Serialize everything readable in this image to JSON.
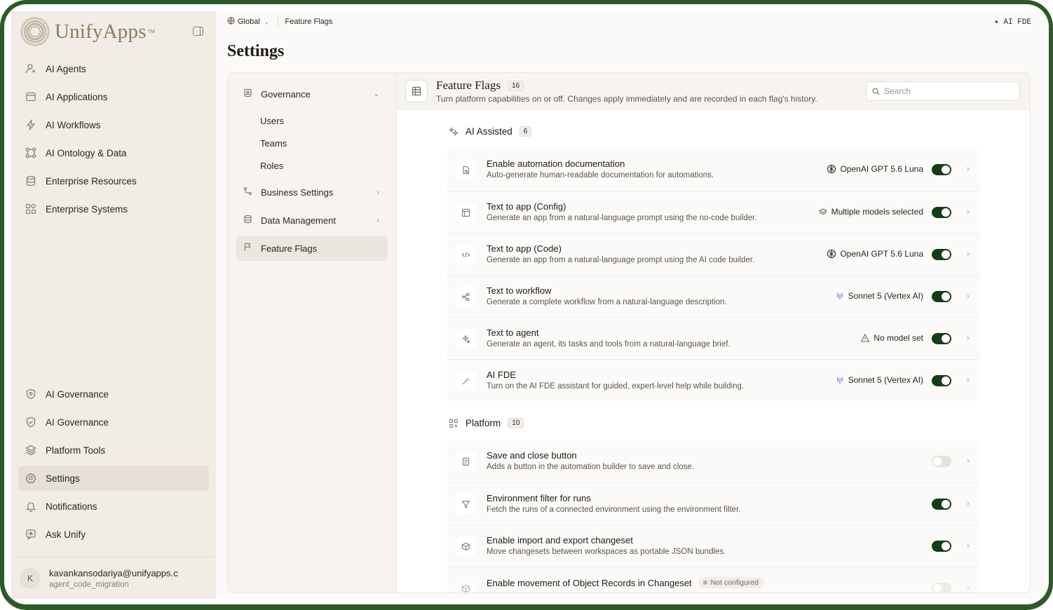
{
  "brand": {
    "name": "UnifyApps",
    "tm": "TM"
  },
  "sidebar": {
    "top_items": [
      {
        "label": "AI Agents",
        "icon": "user-sparkle-icon"
      },
      {
        "label": "AI Applications",
        "icon": "window-icon"
      },
      {
        "label": "AI Workflows",
        "icon": "bolt-icon"
      },
      {
        "label": "AI Ontology & Data",
        "icon": "graph-icon"
      },
      {
        "label": "Enterprise Resources",
        "icon": "database-icon"
      },
      {
        "label": "Enterprise Systems",
        "icon": "grid-icon"
      }
    ],
    "bottom_items": [
      {
        "label": "AI Governance",
        "icon": "shield-icon"
      },
      {
        "label": "AI Governance",
        "icon": "shield-check-icon"
      },
      {
        "label": "Platform Tools",
        "icon": "layers-icon"
      },
      {
        "label": "Settings",
        "icon": "gear-icon",
        "active": true
      },
      {
        "label": "Notifications",
        "icon": "bell-icon"
      },
      {
        "label": "Ask Unify",
        "icon": "chat-icon"
      }
    ],
    "user": {
      "initial": "K",
      "email": "kavankansodariya@unifyapps.c",
      "org": "agent_code_migration"
    }
  },
  "topbar": {
    "scope": "Global",
    "breadcrumb": "Feature Flags",
    "ai_fde": "✦ AI FDE"
  },
  "page": {
    "title": "Settings"
  },
  "settings_nav": {
    "governance": "Governance",
    "sub_items": [
      "Users",
      "Teams",
      "Roles"
    ],
    "business_settings": "Business Settings",
    "data_management": "Data Management",
    "feature_flags": "Feature Flags"
  },
  "feature_flags": {
    "title": "Feature Flags",
    "count": "16",
    "description": "Turn platform capabilities on or off. Changes apply immediately and are recorded in each flag's history.",
    "search_placeholder": "Search",
    "sections": [
      {
        "title": "AI Assisted",
        "count": "6",
        "flags": [
          {
            "name": "Enable automation documentation",
            "desc": "Auto-generate human-readable documentation for automations.",
            "model": "OpenAI GPT 5.6 Luna",
            "model_icon": "openai-icon",
            "enabled": true
          },
          {
            "name": "Text to app (Config)",
            "desc": "Generate an app from a natural-language prompt using the no-code builder.",
            "model": "Multiple models selected",
            "model_icon": "layers-icon",
            "enabled": true
          },
          {
            "name": "Text to app (Code)",
            "desc": "Generate an app from a natural-language prompt using the AI code builder.",
            "model": "OpenAI GPT 5.6 Luna",
            "model_icon": "openai-icon",
            "enabled": true
          },
          {
            "name": "Text to workflow",
            "desc": "Generate a complete workflow from a natural-language description.",
            "model": "Sonnet 5 (Vertex AI)",
            "model_icon": "vertex-icon",
            "enabled": true
          },
          {
            "name": "Text to agent",
            "desc": "Generate an agent, its tasks and tools from a natural-language brief.",
            "model": "No model set",
            "model_icon": "warning-icon",
            "enabled": true
          },
          {
            "name": "AI FDE",
            "desc": "Turn on the AI FDE assistant for guided, expert-level help while building.",
            "model": "Sonnet 5 (Vertex AI)",
            "model_icon": "vertex-icon",
            "enabled": true
          }
        ]
      },
      {
        "title": "Platform",
        "count": "10",
        "flags": [
          {
            "name": "Save and close button",
            "desc": "Adds a button in the automation builder to save and close.",
            "enabled": false
          },
          {
            "name": "Environment filter for runs",
            "desc": "Fetch the runs of a connected environment using the environment filter.",
            "enabled": true
          },
          {
            "name": "Enable import and export changeset",
            "desc": "Move changesets between workspaces as portable JSON bundles.",
            "enabled": true
          },
          {
            "name": "Enable movement of Object Records in Changeset",
            "status": "Not configured",
            "enabled": false
          }
        ]
      }
    ]
  },
  "colors": {
    "accent_toggle": "#143d17",
    "sidebar_bg": "#f1ece6",
    "frame": "#2d5a26"
  }
}
